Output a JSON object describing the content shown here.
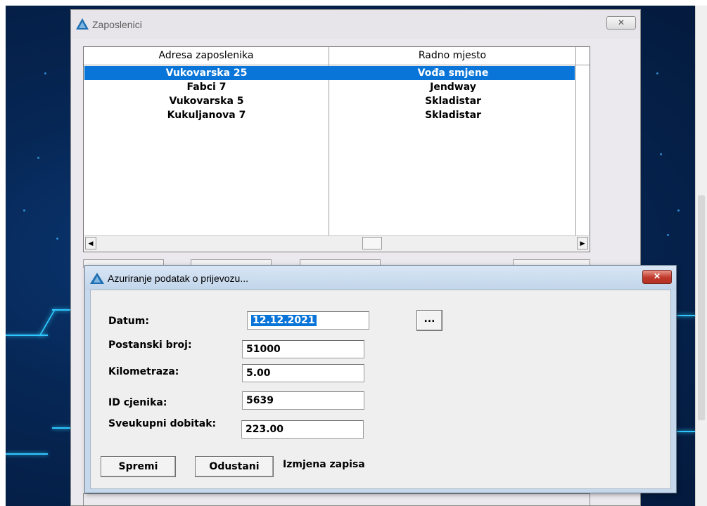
{
  "main_window": {
    "title": "Zaposlenici",
    "close_glyph": "✕"
  },
  "grid": {
    "columns": [
      "Adresa zaposlenika",
      "Radno mjesto"
    ],
    "rows": [
      {
        "adresa": "Vukovarska 25",
        "radno_mjesto": "Vođa smjene",
        "selected": true
      },
      {
        "adresa": "Fabci 7",
        "radno_mjesto": "Jendway",
        "selected": false
      },
      {
        "adresa": "Vukovarska 5",
        "radno_mjesto": "Skladistar",
        "selected": false
      },
      {
        "adresa": "Kukuljanova 7",
        "radno_mjesto": "Skladistar",
        "selected": false
      }
    ],
    "scroll_left_glyph": "◀",
    "scroll_right_glyph": "▶"
  },
  "dialog": {
    "title": "Azuriranje podatak o prijevozu...",
    "close_glyph": "✕",
    "fields": {
      "datum": {
        "label": "Datum:",
        "value": "12.12.2021"
      },
      "postanski_broj": {
        "label": "Postanski broj:",
        "value": "51000"
      },
      "kilometraza": {
        "label": "Kilometraza:",
        "value": "5.00"
      },
      "id_cjenika": {
        "label": "ID cjenika:",
        "value": "5639"
      },
      "sveukupni_dobitak": {
        "label": "Sveukupni dobitak:",
        "value": "223.00"
      }
    },
    "date_picker_label": "...",
    "save_label": "Spremi",
    "cancel_label": "Odustani",
    "status_text": "Izmjena zapisa"
  },
  "colors": {
    "selection": "#0a75d8",
    "dialog_frame": "#c5d8ec",
    "close_red": "#c0392b",
    "wallpaper": "#062654"
  },
  "icons": {
    "app": "blue-triangle-logo-icon"
  }
}
